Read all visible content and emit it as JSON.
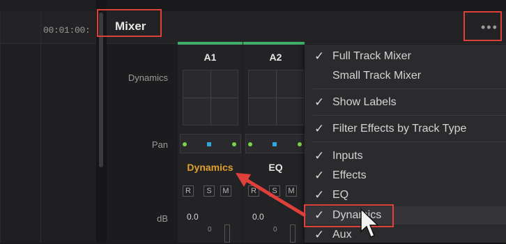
{
  "timeline": {
    "timecode": "00:01:00:"
  },
  "mixer": {
    "title": "Mixer",
    "more_icon": "more-horizontal-icon",
    "row_labels": {
      "dynamics": "Dynamics",
      "pan": "Pan",
      "db": "dB"
    },
    "channels": [
      {
        "name": "A1",
        "effect": "Dynamics",
        "db": "0.0",
        "scale": "0"
      },
      {
        "name": "A2",
        "effect": "EQ",
        "db": "0.0",
        "scale": "0"
      }
    ],
    "buttons": {
      "record": "R",
      "solo": "S",
      "mute": "M"
    },
    "colors": {
      "accent_green": "#3fae6a",
      "dynamics_orange": "#e0a030",
      "annotation_red": "#e0403a",
      "pan_blue": "#2fa7e0"
    }
  },
  "menu": {
    "items": [
      {
        "label": "Full Track Mixer",
        "checked": true
      },
      {
        "label": "Small Track Mixer",
        "checked": false
      },
      {
        "label": "Show Labels",
        "checked": true
      },
      {
        "label": "Filter Effects by Track Type",
        "checked": true
      },
      {
        "label": "Inputs",
        "checked": true
      },
      {
        "label": "Effects",
        "checked": true
      },
      {
        "label": "EQ",
        "checked": true
      },
      {
        "label": "Dynamics",
        "checked": true
      },
      {
        "label": "Aux",
        "checked": true
      }
    ],
    "check_glyph": "✓"
  }
}
